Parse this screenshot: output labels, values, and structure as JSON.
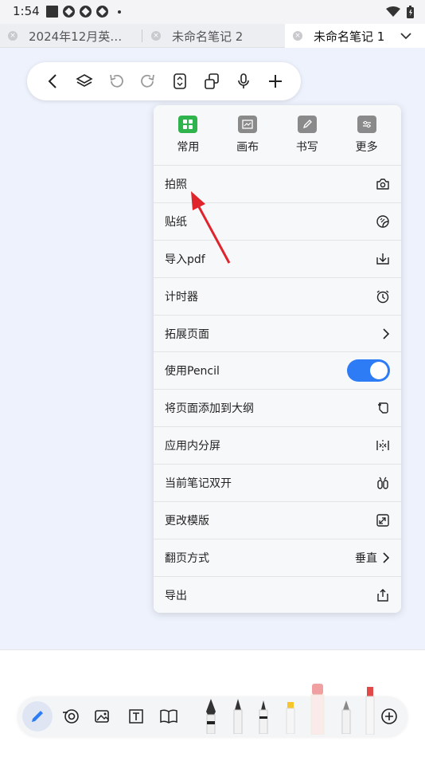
{
  "status": {
    "time": "1:54"
  },
  "tabs": [
    {
      "label": "2024年12月英…"
    },
    {
      "label": "未命名笔记 2"
    },
    {
      "label": "未命名笔记 1"
    }
  ],
  "panel": {
    "categories": [
      {
        "label": "常用"
      },
      {
        "label": "画布"
      },
      {
        "label": "书写"
      },
      {
        "label": "更多"
      }
    ],
    "items": [
      {
        "label": "拍照",
        "icon": "camera-icon"
      },
      {
        "label": "贴纸",
        "icon": "sticker-icon"
      },
      {
        "label": "导入pdf",
        "icon": "import-icon"
      },
      {
        "label": "计时器",
        "icon": "alarm-icon"
      },
      {
        "label": "拓展页面",
        "icon": "chevron-right-icon"
      },
      {
        "label": "使用Pencil",
        "toggle_on": true
      },
      {
        "label": "将页面添加到大纲",
        "icon": "outline-add-icon"
      },
      {
        "label": "应用内分屏",
        "icon": "split-screen-icon"
      },
      {
        "label": "当前笔记双开",
        "icon": "dual-open-icon"
      },
      {
        "label": "更改模版",
        "icon": "template-icon"
      },
      {
        "label": "翻页方式",
        "value": "垂直",
        "icon": "chevron-right-icon"
      },
      {
        "label": "导出",
        "icon": "share-icon"
      }
    ]
  },
  "colors": {
    "accent": "#2d7cf6",
    "active_category": "#2fb34c",
    "canvas_bg": "#eef2fc"
  }
}
